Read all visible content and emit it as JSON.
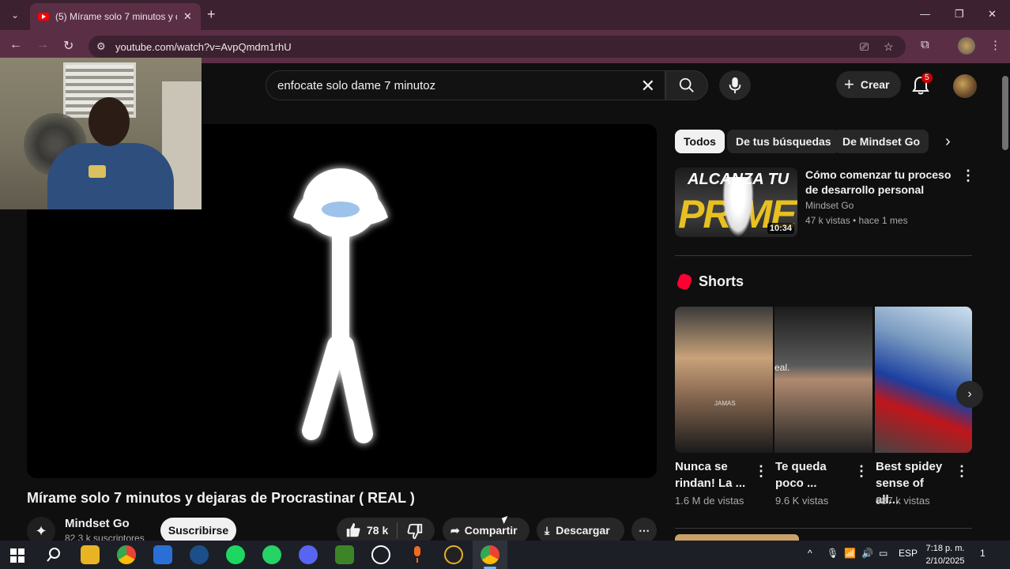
{
  "browser": {
    "tab_title": "(5) Mírame solo 7 minutos y de",
    "url": "youtube.com/watch?v=AvpQmdm1rhU"
  },
  "youtube": {
    "search_query": "enfocate solo dame 7 minutoz",
    "create_label": "Crear",
    "notifications_count": "5"
  },
  "video": {
    "title": "Mírame solo 7 minutos y dejaras de Procrastinar ( REAL )",
    "channel": "Mindset Go",
    "subscribers": "82,3 k suscriptores",
    "subscribe_label": "Suscribirse",
    "likes": "78 k",
    "share_label": "Compartir",
    "download_label": "Descargar"
  },
  "chips": [
    "Todos",
    "De tus búsquedas",
    "De Mindset Go"
  ],
  "recommended": [
    {
      "title": "Cómo comenzar tu proceso de desarrollo personal",
      "channel": "Mindset Go",
      "meta": "47 k vistas • hace 1 mes",
      "duration": "10:34",
      "thumb_line1": "ALCANZA TU",
      "thumb_line2": "PRIME"
    }
  ],
  "shorts": {
    "heading": "Shorts",
    "items": [
      {
        "title": "Nunca se rindan! La ...",
        "views": "1.6 M de vistas",
        "overlay": "JAMAS"
      },
      {
        "title": "Te queda poco ...",
        "views": "9.6 K vistas",
        "overlay": "eal."
      },
      {
        "title": "Best spidey sense of all...",
        "views": "987 k vistas",
        "overlay": ""
      }
    ]
  },
  "taskbar": {
    "language": "ESP",
    "time": "7:18 p. m.",
    "date": "2/10/2025",
    "notification_count": "1"
  },
  "colors": {
    "chrome_tab_bg": "#3c2230",
    "chrome_active": "#5a2f45",
    "yt_bg": "#0f0f0f",
    "yt_red": "#ff0000",
    "chip_active": "#f1f1f1"
  }
}
